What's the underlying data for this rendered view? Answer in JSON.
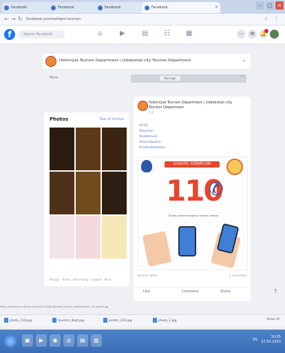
{
  "browser": {
    "tabs": [
      {
        "label": "facebook"
      },
      {
        "label": "Facebook"
      },
      {
        "label": "Facebook"
      },
      {
        "label": "Facebook"
      }
    ],
    "url": "facebook.com/tashkent.tourism"
  },
  "facebook": {
    "logo": "f",
    "search_placeholder": "Search Facebook"
  },
  "page": {
    "name": "Hokimiyat Tourism Department | Uzbekistan city Tourism Department",
    "more_label": "More",
    "action_label": "Message"
  },
  "photos": {
    "title": "Photos",
    "see_all": "See all photos",
    "tiles": [
      {
        "label": "",
        "color": "#2a1b10"
      },
      {
        "label": "",
        "color": "#5b3a1a"
      },
      {
        "label": "",
        "color": "#3a2412"
      },
      {
        "label": "",
        "color": "#4d3219"
      },
      {
        "label": "",
        "color": "#6e4a1d"
      },
      {
        "label": "",
        "color": "#2e1e0f"
      },
      {
        "label": "",
        "color": "#f2e4e8"
      },
      {
        "label": "",
        "color": "#f4d9dd"
      },
      {
        "label": "",
        "color": "#f6e7b8"
      }
    ],
    "caption": "Privacy · Terms · Advertising · Cookies · More"
  },
  "post": {
    "author": "Hokimiyat Tourism Department | Uzbekistan city Tourism Department",
    "time": "3 d",
    "tags": [
      "#110",
      "#tourism",
      "#safetravel",
      "#touristpolice",
      "#visituzbekistan"
    ],
    "poster": {
      "heading": "LOGISTIC XIZMATLARI",
      "number": "110",
      "text": "Tourist police emergency service number"
    },
    "reactions": "Ishonch kanali",
    "comments": "2 comments",
    "actions": [
      "Like",
      "Comment",
      "Share"
    ]
  },
  "status_url": "https://scontent.xx.fbcdn.net/v/t39.30808-6/photo_tourism_department_110_poster.jpg",
  "downloads": [
    {
      "name": "photo_110.jpg"
    },
    {
      "name": "tourism_dept.jpg"
    },
    {
      "name": "poster_110.jpg"
    },
    {
      "name": "photo_2.jpg"
    }
  ],
  "downloads_show_all": "Show all",
  "taskbar": {
    "time": "10:25",
    "date": "27.03.2023",
    "tray": "EN"
  },
  "colors": {
    "accent": "#1877f2",
    "poster_red": "#e7452c",
    "poster_blue": "#2c57a8"
  }
}
